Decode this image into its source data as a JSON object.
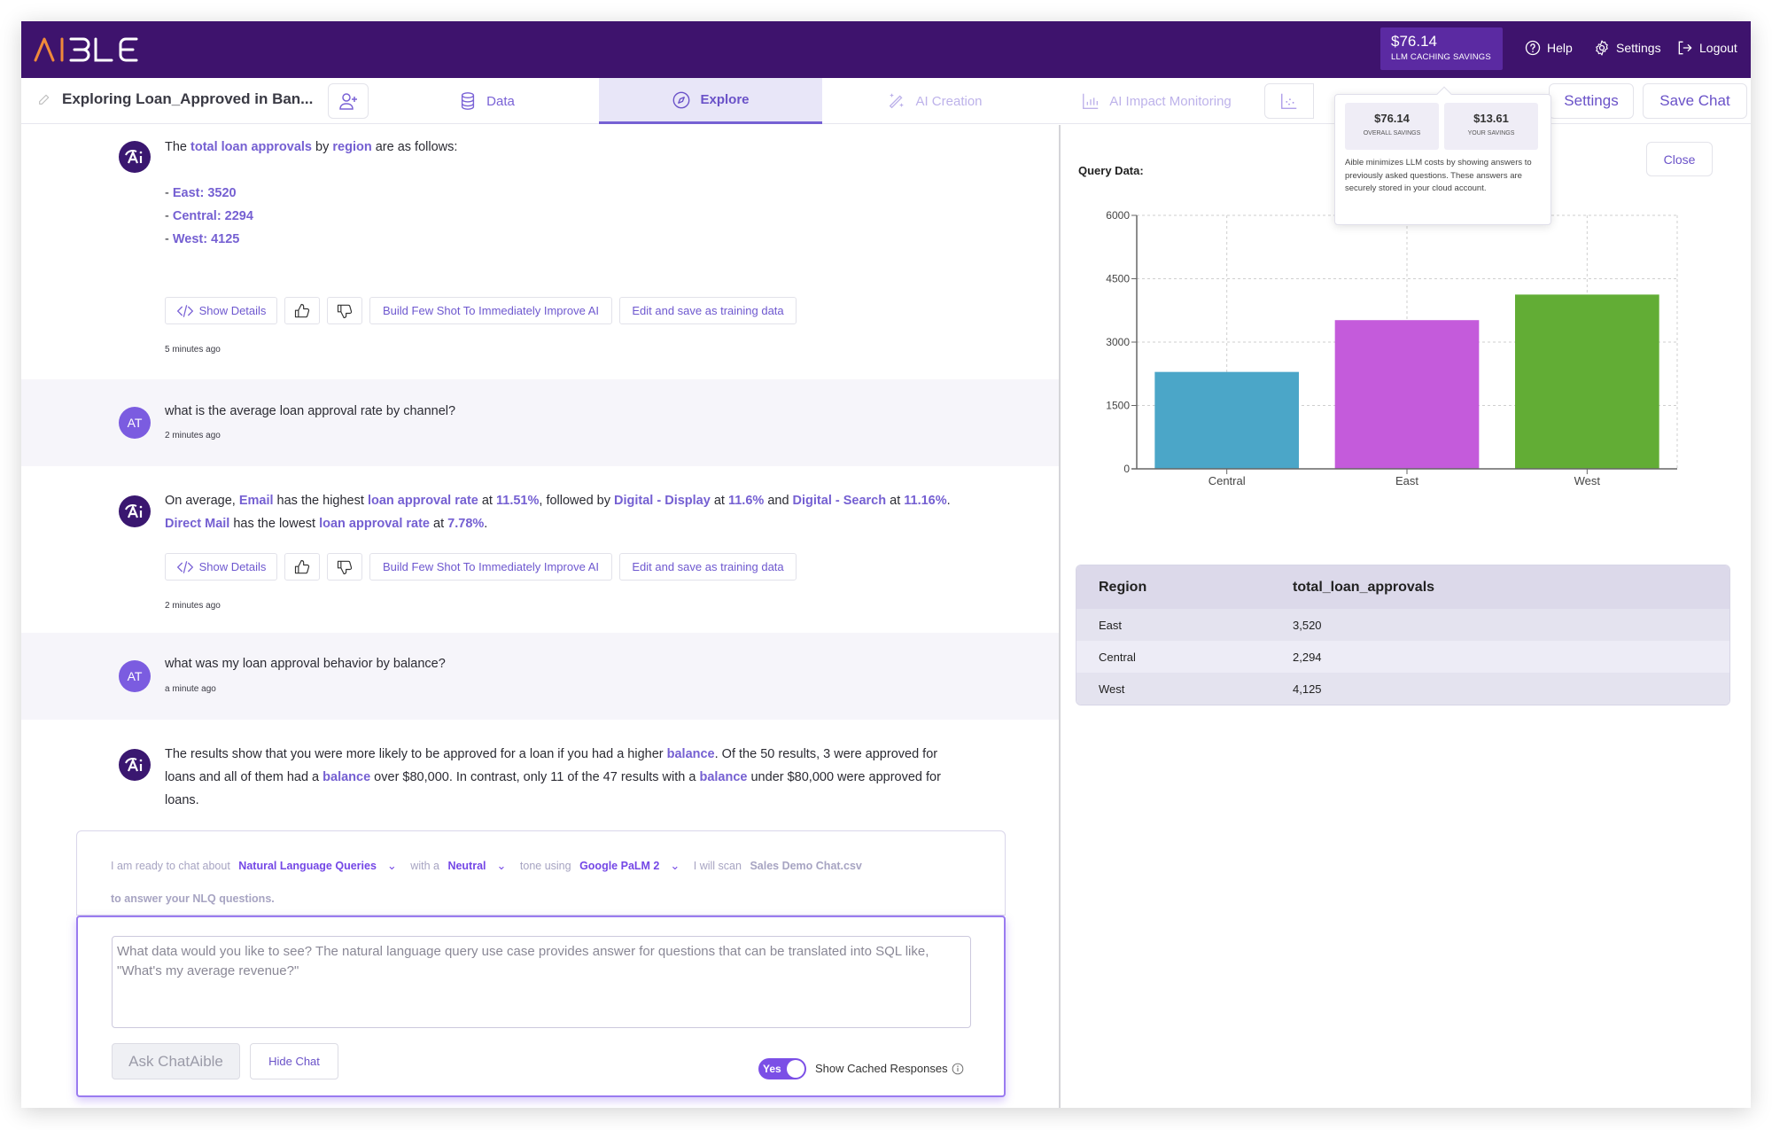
{
  "app": {
    "logo_text": "AIBLE",
    "savings": {
      "amount": "$76.14",
      "label": "LLM CACHING SAVINGS"
    },
    "nav": {
      "help": "Help",
      "settings": "Settings",
      "logout": "Logout"
    }
  },
  "subbar": {
    "chat_title": "Exploring Loan_Approved in Ban...",
    "tabs": [
      {
        "label": "Data",
        "icon": "database-icon",
        "state": "normal"
      },
      {
        "label": "Explore",
        "icon": "compass-icon",
        "state": "active"
      },
      {
        "label": "AI Creation",
        "icon": "magic-wand-icon",
        "state": "disabled"
      },
      {
        "label": "AI Impact Monitoring",
        "icon": "bar-chart-icon",
        "state": "disabled"
      }
    ],
    "settings_label": "Settings",
    "save_chat_label": "Save Chat"
  },
  "popover": {
    "overall": {
      "value": "$76.14",
      "label": "OVERALL SAVINGS"
    },
    "yours": {
      "value": "$13.61",
      "label": "YOUR SAVINGS"
    },
    "description": "Aible minimizes LLM costs by showing answers to previously asked questions. These answers are securely stored in your cloud account."
  },
  "chat": {
    "messages": [
      {
        "role": "ai",
        "parts": [
          {
            "t": "The "
          },
          {
            "t": "total loan approvals",
            "hl": true
          },
          {
            "t": " by "
          },
          {
            "t": "region",
            "hl": true
          },
          {
            "t": " are as follows:"
          }
        ],
        "list": [
          {
            "prefix": "- ",
            "text": "East: 3520"
          },
          {
            "prefix": "- ",
            "text": "Central: 2294"
          },
          {
            "prefix": "- ",
            "text": "West: 4125"
          }
        ],
        "timestamp": "5 minutes ago"
      },
      {
        "role": "user",
        "initials": "AT",
        "text": "what is the average loan approval rate by channel?",
        "timestamp": "2 minutes ago"
      },
      {
        "role": "ai",
        "parts": [
          {
            "t": "On average, "
          },
          {
            "t": "Email",
            "hl": true
          },
          {
            "t": " has the highest "
          },
          {
            "t": "loan approval rate",
            "hl": true
          },
          {
            "t": " at "
          },
          {
            "t": "11.51%",
            "hl": true
          },
          {
            "t": ", followed by "
          },
          {
            "t": "Digital - Display",
            "hl": true
          },
          {
            "t": " at "
          },
          {
            "t": "11.6%",
            "hl": true
          },
          {
            "t": " and "
          },
          {
            "t": "Digital - Search",
            "hl": true
          },
          {
            "t": " at "
          },
          {
            "t": "11.16%",
            "hl": true
          },
          {
            "t": ". "
          },
          {
            "t": "Direct Mail",
            "hl": true
          },
          {
            "t": " has the lowest "
          },
          {
            "t": "loan approval rate",
            "hl": true
          },
          {
            "t": " at "
          },
          {
            "t": "7.78%",
            "hl": true
          },
          {
            "t": "."
          }
        ],
        "timestamp": "2 minutes ago"
      },
      {
        "role": "user",
        "initials": "AT",
        "text": "what was my loan approval behavior by balance?",
        "timestamp": "a minute ago"
      },
      {
        "role": "ai",
        "parts": [
          {
            "t": "The results show that you were more likely to be approved for a loan if you had a higher "
          },
          {
            "t": "balance",
            "hl": true
          },
          {
            "t": ". Of the 50 results, 3 were approved for loans and all of them had a "
          },
          {
            "t": "balance",
            "hl": true
          },
          {
            "t": " over $80,000. In contrast, only 11 of the 47 results with a "
          },
          {
            "t": "balance",
            "hl": true
          },
          {
            "t": " under $80,000 were approved for loans."
          }
        ]
      }
    ],
    "actions": {
      "show_details": "Show Details",
      "build_few_shot": "Build Few Shot To Immediately Improve AI",
      "edit_save": "Edit and save as training data"
    }
  },
  "composer": {
    "intro": "I am ready to chat about",
    "topic": "Natural Language Queries",
    "with_a": "with a",
    "tone": "Neutral",
    "tone_using": "tone using",
    "model": "Google PaLM 2",
    "will_scan": "I will scan",
    "file": "Sales Demo Chat.csv",
    "outro": "to answer your NLQ questions.",
    "placeholder": "What data would you like to see? The natural language query use case provides answer for questions that can be translated into SQL like, \"What's my average revenue?\"",
    "value": "",
    "ask_label": "Ask ChatAible",
    "hide_label": "Hide Chat",
    "toggle_label": "Yes",
    "toggle_on": true,
    "cached_label": "Show Cached Responses"
  },
  "query_panel": {
    "label": "Query Data:",
    "close_label": "Close",
    "table": {
      "headers": [
        "Region",
        "total_loan_approvals"
      ],
      "rows": [
        [
          "East",
          "3,520"
        ],
        [
          "Central",
          "2,294"
        ],
        [
          "West",
          "4,125"
        ]
      ]
    }
  },
  "chart_data": {
    "type": "bar",
    "title": "",
    "xlabel": "",
    "ylabel": "",
    "categories": [
      "Central",
      "East",
      "West"
    ],
    "values": [
      2294,
      3520,
      4125
    ],
    "colors": [
      "#4ba6c8",
      "#c45bdb",
      "#62ad35"
    ],
    "ylim": [
      0,
      6000
    ],
    "yticks": [
      0,
      1500,
      3000,
      4500,
      6000
    ],
    "grid": true,
    "legend": "none"
  },
  "colors": {
    "brand_purple": "#3e136d",
    "accent": "#7560d2",
    "savings_pill": "#5b2aa2"
  }
}
